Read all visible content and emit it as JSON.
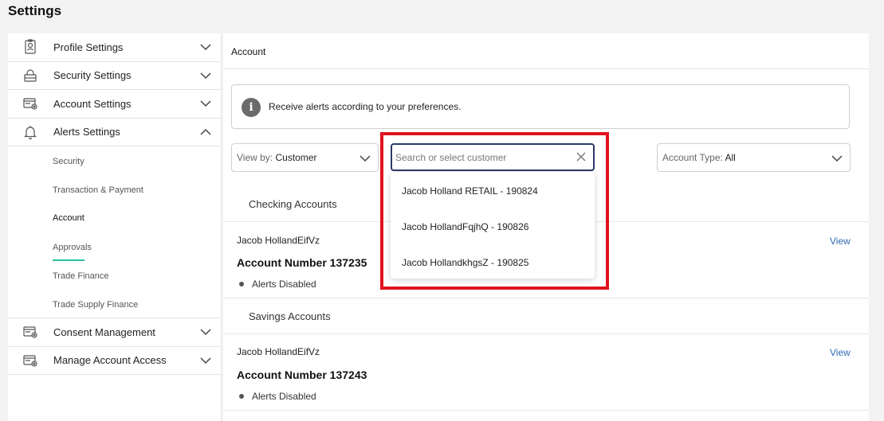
{
  "page_title": "Settings",
  "sidebar": {
    "items": [
      {
        "label": "Profile Settings",
        "icon": "profile-card-icon",
        "expanded": false
      },
      {
        "label": "Security Settings",
        "icon": "security-lock-icon",
        "expanded": false
      },
      {
        "label": "Account Settings",
        "icon": "account-settings-icon",
        "expanded": false
      },
      {
        "label": "Alerts Settings",
        "icon": "bell-gear-icon",
        "expanded": true
      },
      {
        "label": "Consent Management",
        "icon": "consent-icon",
        "expanded": false
      },
      {
        "label": "Manage Account Access",
        "icon": "account-access-icon",
        "expanded": false
      }
    ],
    "alerts_sub_items": [
      "Security",
      "Transaction & Payment",
      "Account",
      "Approvals",
      "Trade Finance",
      "Trade Supply Finance"
    ],
    "active_sub_item": "Account"
  },
  "main": {
    "title": "Account",
    "info_text": "Receive alerts according to your preferences.",
    "view_by": {
      "label": "View by:",
      "value": "Customer"
    },
    "search": {
      "placeholder": "Search or select customer",
      "value": ""
    },
    "account_type": {
      "label": "Account Type:",
      "value": "All"
    },
    "dropdown_options": [
      "Jacob Holland RETAIL - 190824",
      "Jacob HollandFqjhQ - 190826",
      "Jacob HollandkhgsZ - 190825"
    ],
    "sections": [
      {
        "label": "Checking Accounts",
        "account": {
          "name": "Jacob HollandEifVz",
          "number": "Account Number 137235",
          "status": "Alerts Disabled",
          "view_label": "View"
        }
      },
      {
        "label": "Savings Accounts",
        "account": {
          "name": "Jacob HollandEifVz",
          "number": "Account Number 137243",
          "status": "Alerts Disabled",
          "view_label": "View"
        }
      }
    ]
  },
  "colors": {
    "accent_underline": "#2bbfa0",
    "highlight_border": "#e0141e",
    "link": "#2f6bb3",
    "search_border": "#2b3a67"
  }
}
